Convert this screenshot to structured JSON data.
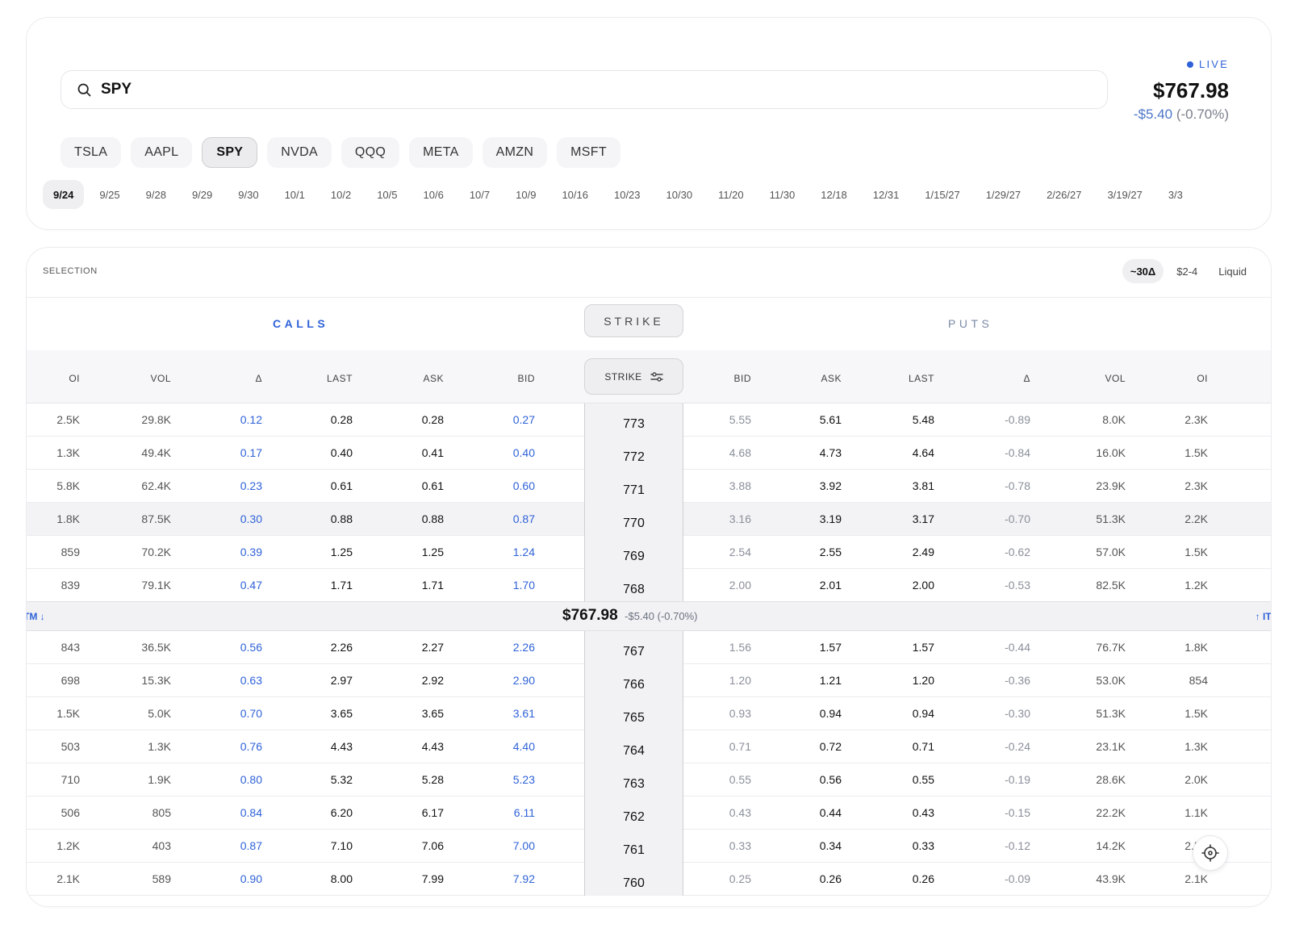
{
  "search": {
    "value": "SPY"
  },
  "quote": {
    "live_label": "LIVE",
    "price": "$767.98",
    "change_dollar": "-$5.40",
    "change_pct": "(-0.70%)"
  },
  "tickers": [
    {
      "label": "TSLA"
    },
    {
      "label": "AAPL"
    },
    {
      "label": "SPY",
      "active": true
    },
    {
      "label": "NVDA"
    },
    {
      "label": "QQQ"
    },
    {
      "label": "META"
    },
    {
      "label": "AMZN"
    },
    {
      "label": "MSFT"
    }
  ],
  "dates": [
    "9/24",
    "9/25",
    "9/28",
    "9/29",
    "9/30",
    "10/1",
    "10/2",
    "10/5",
    "10/6",
    "10/7",
    "10/9",
    "10/16",
    "10/23",
    "10/30",
    "11/20",
    "11/30",
    "12/18",
    "12/31",
    "1/15/27",
    "1/29/27",
    "2/26/27",
    "3/19/27",
    "3/3"
  ],
  "active_date": "9/24",
  "selection": {
    "label": "SELECTION",
    "filters": [
      "~30Δ",
      "$2-4",
      "Liquid"
    ],
    "active_filter": "~30Δ"
  },
  "chain": {
    "calls_label": "CALLS",
    "strike_label": "STRIKE",
    "puts_label": "PUTS",
    "call_columns": [
      "OI",
      "VOL",
      "Δ",
      "LAST",
      "ASK",
      "BID"
    ],
    "strike_column": "STRIKE",
    "put_columns": [
      "BID",
      "ASK",
      "LAST",
      "Δ",
      "VOL",
      "OI"
    ],
    "atm_left": "TM ↓",
    "atm_right": "↑ ITI",
    "atm_price": "$767.98",
    "atm_change": "-$5.40 (-0.70%)",
    "rows_above": [
      {
        "call": [
          "2.5K",
          "29.8K",
          "0.12",
          "0.28",
          "0.28",
          "0.27"
        ],
        "strike": "773",
        "put": [
          "5.55",
          "5.61",
          "5.48",
          "-0.89",
          "8.0K",
          "2.3K"
        ]
      },
      {
        "call": [
          "1.3K",
          "49.4K",
          "0.17",
          "0.40",
          "0.41",
          "0.40"
        ],
        "strike": "772",
        "put": [
          "4.68",
          "4.73",
          "4.64",
          "-0.84",
          "16.0K",
          "1.5K"
        ]
      },
      {
        "call": [
          "5.8K",
          "62.4K",
          "0.23",
          "0.61",
          "0.61",
          "0.60"
        ],
        "strike": "771",
        "put": [
          "3.88",
          "3.92",
          "3.81",
          "-0.78",
          "23.9K",
          "2.3K"
        ]
      },
      {
        "call": [
          "1.8K",
          "87.5K",
          "0.30",
          "0.88",
          "0.88",
          "0.87"
        ],
        "strike": "770",
        "put": [
          "3.16",
          "3.19",
          "3.17",
          "-0.70",
          "51.3K",
          "2.2K"
        ],
        "highlight": true
      },
      {
        "call": [
          "859",
          "70.2K",
          "0.39",
          "1.25",
          "1.25",
          "1.24"
        ],
        "strike": "769",
        "put": [
          "2.54",
          "2.55",
          "2.49",
          "-0.62",
          "57.0K",
          "1.5K"
        ]
      },
      {
        "call": [
          "839",
          "79.1K",
          "0.47",
          "1.71",
          "1.71",
          "1.70"
        ],
        "strike": "768",
        "put": [
          "2.00",
          "2.01",
          "2.00",
          "-0.53",
          "82.5K",
          "1.2K"
        ]
      }
    ],
    "rows_below": [
      {
        "call": [
          "843",
          "36.5K",
          "0.56",
          "2.26",
          "2.27",
          "2.26"
        ],
        "strike": "767",
        "put": [
          "1.56",
          "1.57",
          "1.57",
          "-0.44",
          "76.7K",
          "1.8K"
        ]
      },
      {
        "call": [
          "698",
          "15.3K",
          "0.63",
          "2.97",
          "2.92",
          "2.90"
        ],
        "strike": "766",
        "put": [
          "1.20",
          "1.21",
          "1.20",
          "-0.36",
          "53.0K",
          "854"
        ]
      },
      {
        "call": [
          "1.5K",
          "5.0K",
          "0.70",
          "3.65",
          "3.65",
          "3.61"
        ],
        "strike": "765",
        "put": [
          "0.93",
          "0.94",
          "0.94",
          "-0.30",
          "51.3K",
          "1.5K"
        ]
      },
      {
        "call": [
          "503",
          "1.3K",
          "0.76",
          "4.43",
          "4.43",
          "4.40"
        ],
        "strike": "764",
        "put": [
          "0.71",
          "0.72",
          "0.71",
          "-0.24",
          "23.1K",
          "1.3K"
        ]
      },
      {
        "call": [
          "710",
          "1.9K",
          "0.80",
          "5.32",
          "5.28",
          "5.23"
        ],
        "strike": "763",
        "put": [
          "0.55",
          "0.56",
          "0.55",
          "-0.19",
          "28.6K",
          "2.0K"
        ]
      },
      {
        "call": [
          "506",
          "805",
          "0.84",
          "6.20",
          "6.17",
          "6.11"
        ],
        "strike": "762",
        "put": [
          "0.43",
          "0.44",
          "0.43",
          "-0.15",
          "22.2K",
          "1.1K"
        ]
      },
      {
        "call": [
          "1.2K",
          "403",
          "0.87",
          "7.10",
          "7.06",
          "7.00"
        ],
        "strike": "761",
        "put": [
          "0.33",
          "0.34",
          "0.33",
          "-0.12",
          "14.2K",
          "2.5K"
        ]
      },
      {
        "call": [
          "2.1K",
          "589",
          "0.90",
          "8.00",
          "7.99",
          "7.92"
        ],
        "strike": "760",
        "put": [
          "0.25",
          "0.26",
          "0.26",
          "-0.09",
          "43.9K",
          "2.1K"
        ]
      }
    ]
  },
  "icons": {
    "search": "search-icon",
    "filter": "sliders-icon",
    "recenter": "crosshair-icon"
  },
  "colors": {
    "accent": "#2f62d8",
    "muted": "#8a8f9a"
  }
}
